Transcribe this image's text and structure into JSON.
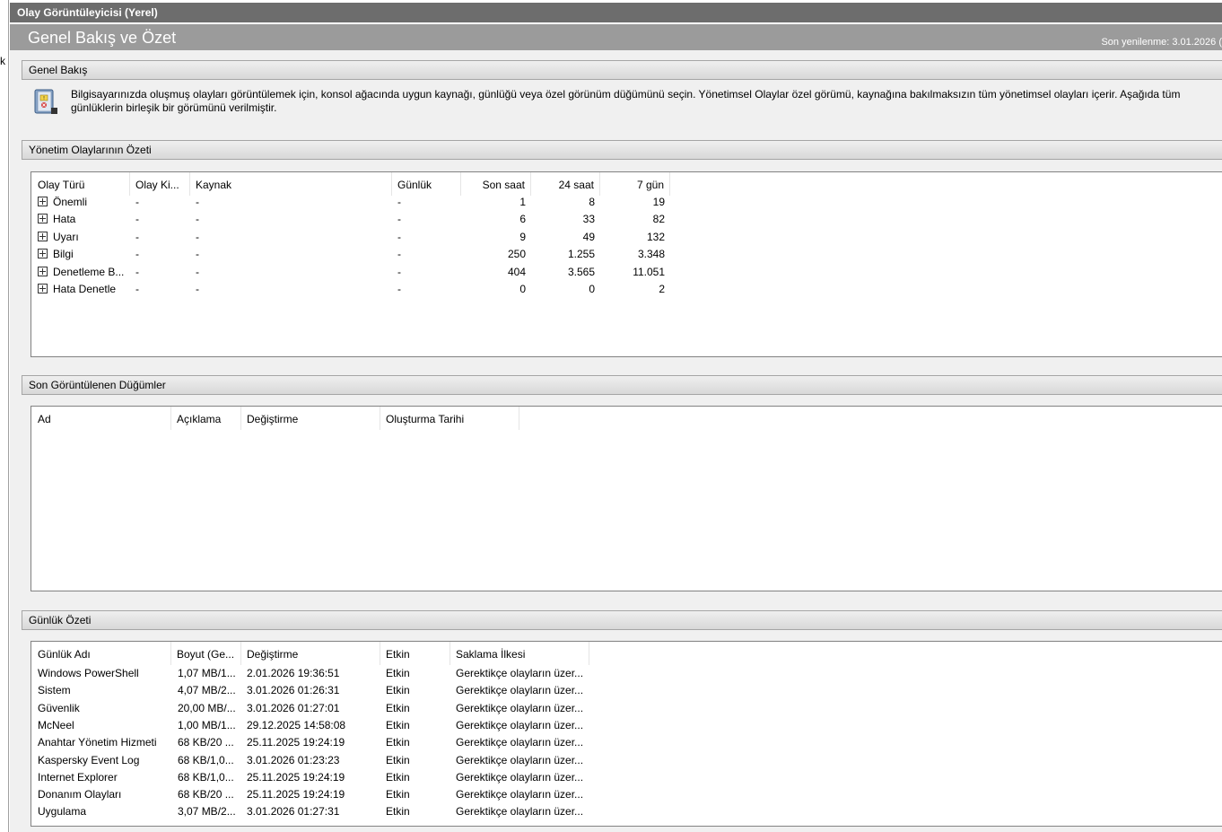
{
  "left_fragment": "k",
  "window_title": "Olay Görüntüleyicisi (Yerel)",
  "page_title": "Genel Bakış ve Özet",
  "refresh_text": "Son yenilenme: 3.01.2026 (",
  "overview": {
    "header": "Genel Bakış",
    "text": "Bilgisayarınızda oluşmuş olayları görüntülemek için, konsol ağacında uygun kaynağı, günlüğü veya özel görünüm düğümünü seçin. Yönetimsel Olaylar özel görümü, kaynağına bakılmaksızın tüm yönetimsel olayları içerir. Aşağıda tüm günlüklerin birleşik bir görümünü verilmiştir."
  },
  "admin_summary": {
    "header": "Yönetim Olaylarının Özeti",
    "columns": [
      "Olay Türü",
      "Olay Ki...",
      "Kaynak",
      "Günlük",
      "Son saat",
      "24 saat",
      "7 gün"
    ],
    "rows": [
      {
        "type": "Önemli",
        "id": "-",
        "source": "-",
        "log": "-",
        "last_hour": "1",
        "h24": "8",
        "d7": "19"
      },
      {
        "type": "Hata",
        "id": "-",
        "source": "-",
        "log": "-",
        "last_hour": "6",
        "h24": "33",
        "d7": "82"
      },
      {
        "type": "Uyarı",
        "id": "-",
        "source": "-",
        "log": "-",
        "last_hour": "9",
        "h24": "49",
        "d7": "132"
      },
      {
        "type": "Bilgi",
        "id": "-",
        "source": "-",
        "log": "-",
        "last_hour": "250",
        "h24": "1.255",
        "d7": "3.348"
      },
      {
        "type": "Denetleme B...",
        "id": "-",
        "source": "-",
        "log": "-",
        "last_hour": "404",
        "h24": "3.565",
        "d7": "11.051"
      },
      {
        "type": "Hata Denetle",
        "id": "-",
        "source": "-",
        "log": "-",
        "last_hour": "0",
        "h24": "0",
        "d7": "2"
      }
    ]
  },
  "recent_nodes": {
    "header": "Son Görüntülenen Düğümler",
    "columns": [
      "Ad",
      "Açıklama",
      "Değiştirme",
      "Oluşturma Tarihi"
    ]
  },
  "log_summary": {
    "header": "Günlük Özeti",
    "columns": [
      "Günlük Adı",
      "Boyut (Ge...",
      "Değiştirme",
      "Etkin",
      "Saklama İlkesi"
    ],
    "rows": [
      {
        "name": "Windows PowerShell",
        "size": "1,07 MB/1...",
        "modified": "2.01.2026 19:36:51",
        "enabled": "Etkin",
        "policy": "Gerektikçe olayların üzer..."
      },
      {
        "name": "Sistem",
        "size": "4,07 MB/2...",
        "modified": "3.01.2026 01:26:31",
        "enabled": "Etkin",
        "policy": "Gerektikçe olayların üzer..."
      },
      {
        "name": "Güvenlik",
        "size": "20,00 MB/...",
        "modified": "3.01.2026 01:27:01",
        "enabled": "Etkin",
        "policy": "Gerektikçe olayların üzer..."
      },
      {
        "name": "McNeel",
        "size": "1,00 MB/1...",
        "modified": "29.12.2025 14:58:08",
        "enabled": "Etkin",
        "policy": "Gerektikçe olayların üzer..."
      },
      {
        "name": "Anahtar Yönetim Hizmeti",
        "size": "68 KB/20 ...",
        "modified": "25.11.2025 19:24:19",
        "enabled": "Etkin",
        "policy": "Gerektikçe olayların üzer..."
      },
      {
        "name": "Kaspersky Event Log",
        "size": "68 KB/1,0...",
        "modified": "3.01.2026 01:23:23",
        "enabled": "Etkin",
        "policy": "Gerektikçe olayların üzer..."
      },
      {
        "name": "Internet Explorer",
        "size": "68 KB/1,0...",
        "modified": "25.11.2025 19:24:19",
        "enabled": "Etkin",
        "policy": "Gerektikçe olayların üzer..."
      },
      {
        "name": "Donanım Olayları",
        "size": "68 KB/20 ...",
        "modified": "25.11.2025 19:24:19",
        "enabled": "Etkin",
        "policy": "Gerektikçe olayların üzer..."
      },
      {
        "name": "Uygulama",
        "size": "3,07 MB/2...",
        "modified": "3.01.2026 01:27:31",
        "enabled": "Etkin",
        "policy": "Gerektikçe olayların üzer..."
      }
    ]
  }
}
